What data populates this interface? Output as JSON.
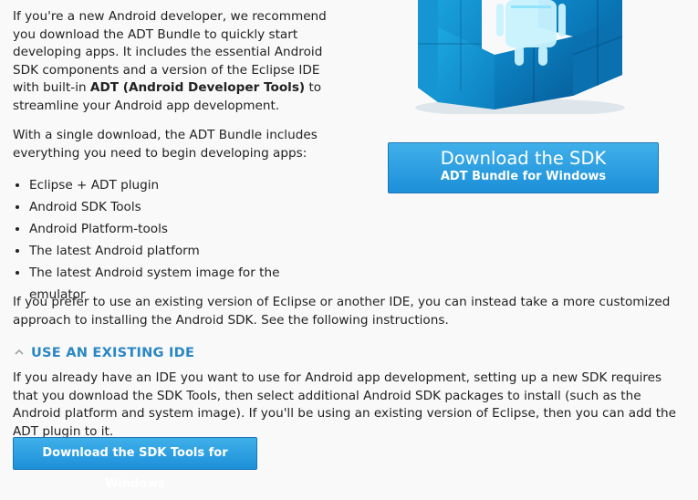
{
  "intro": {
    "p1_text": "If you're a new Android developer, we recommend you download the ADT Bundle to quickly start developing apps. It includes the essential Android SDK components and a version of the Eclipse IDE with built-in ",
    "p1_bold": "ADT (Android Developer Tools)",
    "p1_tail": " to streamline your Android app development.",
    "p2": "With a single download, the ADT Bundle includes everything you need to begin developing apps:",
    "features": [
      "Eclipse + ADT plugin",
      "Android SDK Tools",
      "Android Platform-tools",
      "The latest Android platform",
      "The latest Android system image for the emulator"
    ]
  },
  "download_button": {
    "main": "Download the SDK",
    "sub": "ADT Bundle for Windows"
  },
  "existing_ide_intro": "If you prefer to use an existing version of Eclipse or another IDE, you can instead take a more customized approach to installing the Android SDK. See the following instructions.",
  "section": {
    "title": "USE AN EXISTING IDE",
    "body": "If you already have an IDE you want to use for Android app development, setting up a new SDK requires that you download the SDK Tools, then select additional Android SDK packages to install (such as the Android platform and system image). If you'll be using an existing version of Eclipse, then you can add the ADT plugin to it.",
    "button": "Download the SDK Tools for Windows"
  },
  "colors": {
    "accent": "#2a87c4",
    "button_top": "#40b0ea",
    "button_bottom": "#1c8fd8"
  }
}
